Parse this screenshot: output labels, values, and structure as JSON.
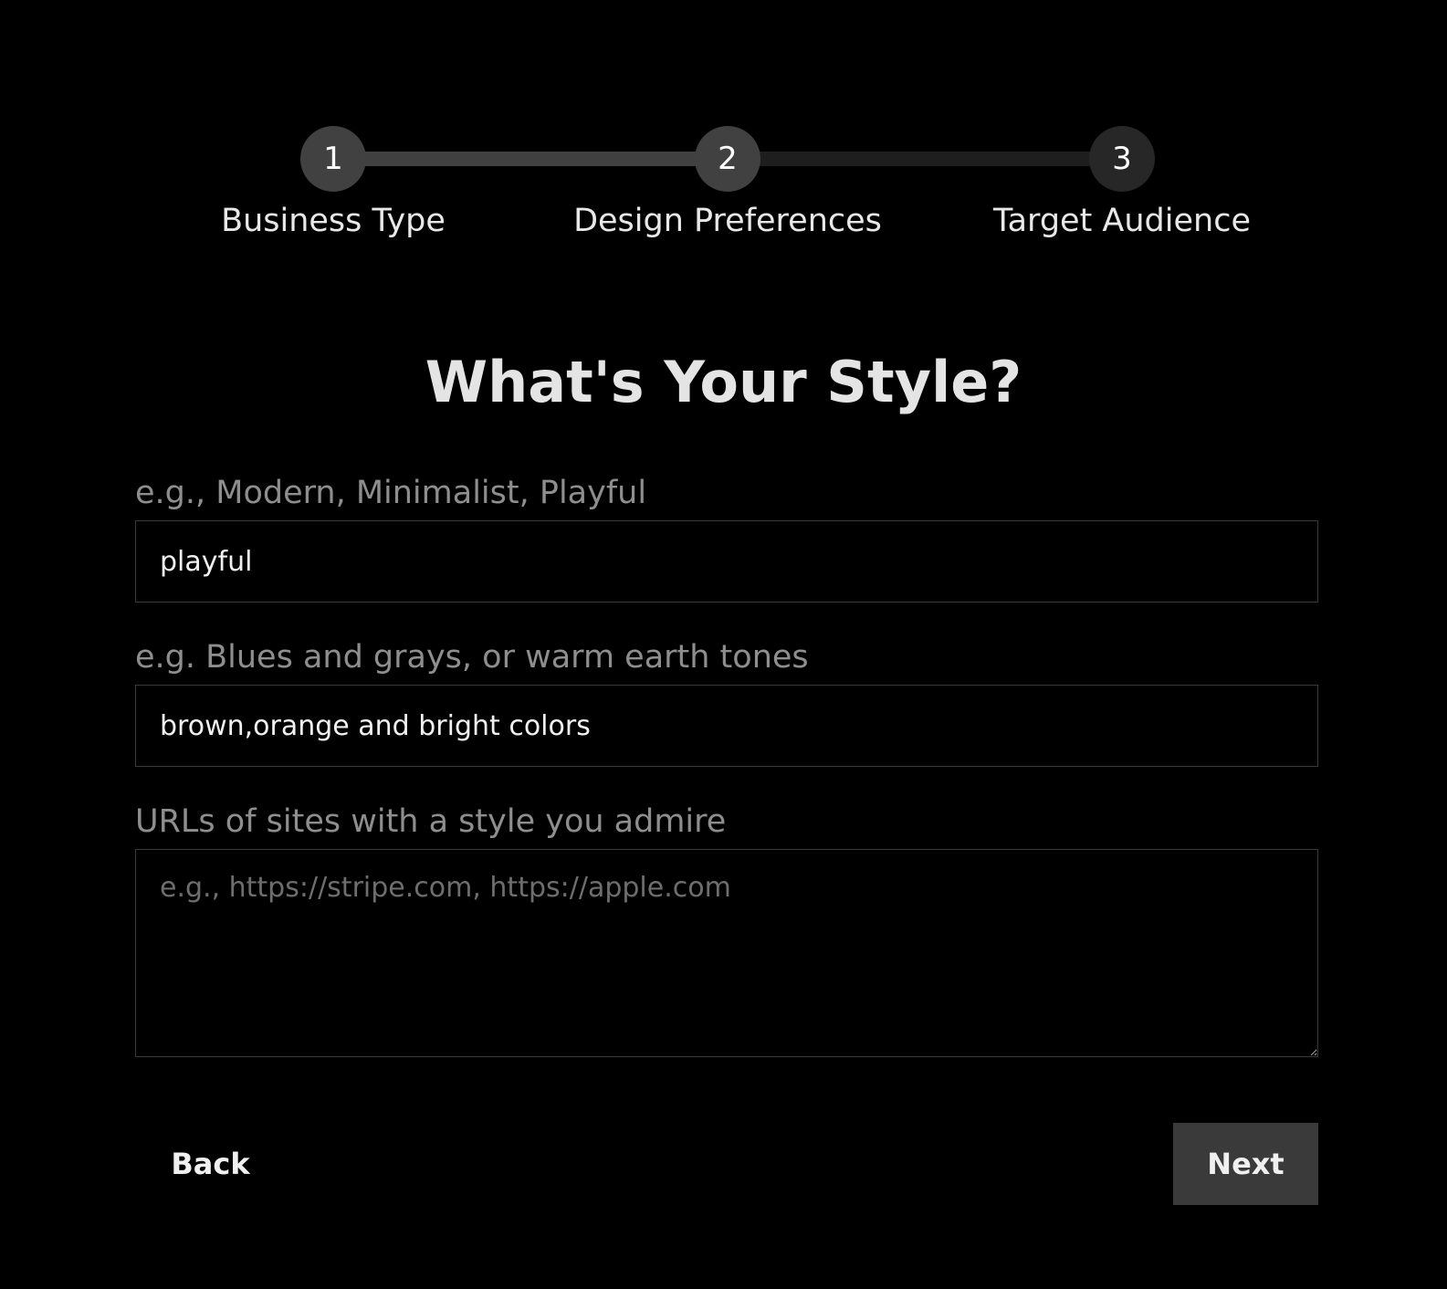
{
  "stepper": {
    "steps": [
      {
        "number": "1",
        "label": "Business Type"
      },
      {
        "number": "2",
        "label": "Design Preferences"
      },
      {
        "number": "3",
        "label": "Target Audience"
      }
    ],
    "current_step": 2
  },
  "page_title": "What's Your Style?",
  "form": {
    "style": {
      "label": "e.g., Modern, Minimalist, Playful",
      "value": "playful"
    },
    "colors": {
      "label": "e.g. Blues and grays, or warm earth tones",
      "value": "brown,orange and bright colors"
    },
    "urls": {
      "label": "URLs of sites with a style you admire",
      "value": "",
      "placeholder": "e.g., https://stripe.com, https://apple.com"
    }
  },
  "buttons": {
    "back_label": "Back",
    "next_label": "Next"
  },
  "colors": {
    "background": "#000000",
    "step_active": "#414141",
    "step_inactive": "#272727",
    "next_button": "#3a3a3a"
  }
}
